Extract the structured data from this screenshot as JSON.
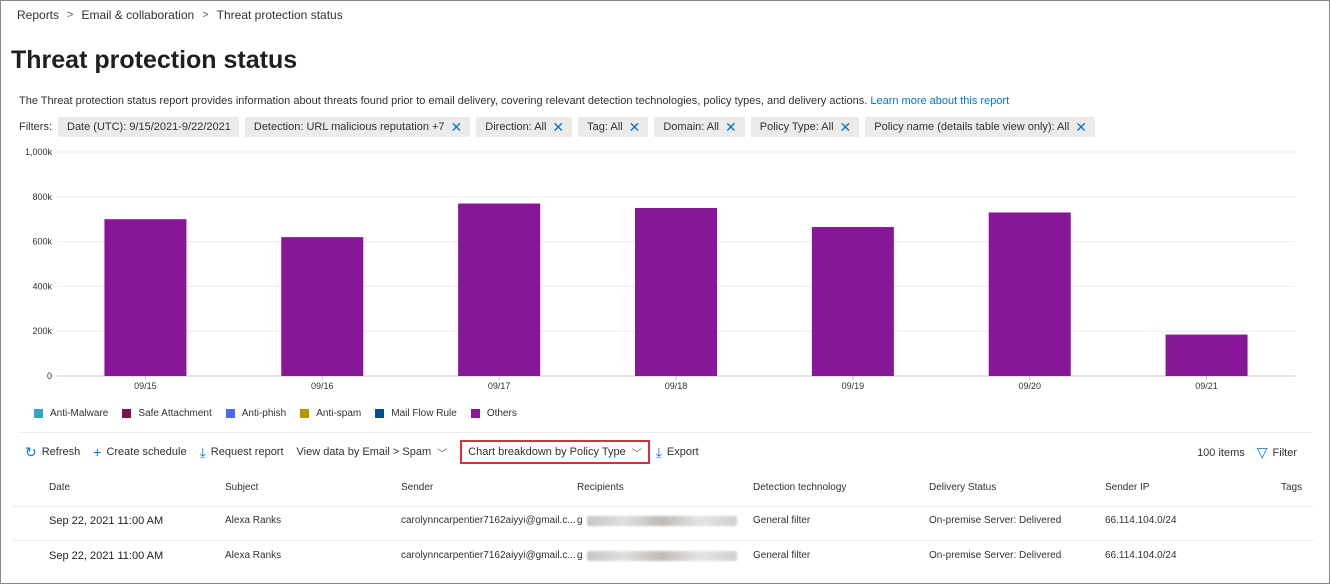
{
  "breadcrumb": [
    "Reports",
    "Email & collaboration",
    "Threat protection status"
  ],
  "page": {
    "title": "Threat protection status",
    "description": "The Threat protection status report provides information about threats found prior to email delivery, covering relevant detection technologies, policy types, and delivery actions.",
    "learn_more": "Learn more about this report"
  },
  "filters": {
    "label": "Filters:",
    "items": [
      "Date (UTC): 9/15/2021-9/22/2021",
      "Detection: URL malicious reputation +7",
      "Direction: All",
      "Tag: All",
      "Domain: All",
      "Policy Type: All",
      "Policy name (details table view only): All"
    ],
    "removable": [
      false,
      true,
      true,
      true,
      true,
      true,
      true
    ]
  },
  "chart_data": {
    "type": "bar",
    "categories": [
      "09/15",
      "09/16",
      "09/17",
      "09/18",
      "09/19",
      "09/20",
      "09/21"
    ],
    "series": [
      {
        "name": "Anti-Malware",
        "color": "#2ea8c2",
        "values": [
          0,
          0,
          0,
          0,
          0,
          0,
          0
        ]
      },
      {
        "name": "Safe Attachment",
        "color": "#7a1350",
        "values": [
          0,
          0,
          0,
          0,
          0,
          0,
          0
        ]
      },
      {
        "name": "Anti-phish",
        "color": "#4f6bed",
        "values": [
          0,
          0,
          0,
          0,
          0,
          0,
          0
        ]
      },
      {
        "name": "Anti-spam",
        "color": "#b89500",
        "values": [
          0,
          0,
          0,
          0,
          0,
          0,
          0
        ]
      },
      {
        "name": "Mail Flow Rule",
        "color": "#004e8c",
        "values": [
          0,
          0,
          0,
          0,
          0,
          0,
          0
        ]
      },
      {
        "name": "Others",
        "color": "#881798",
        "values": [
          700000,
          620000,
          770000,
          750000,
          665000,
          730000,
          185000
        ]
      }
    ],
    "ylim": [
      0,
      1000000
    ],
    "yticks": [
      0,
      200000,
      400000,
      600000,
      800000,
      1000000
    ],
    "ytick_labels": [
      "0",
      "200k",
      "400k",
      "600k",
      "800k",
      "1,000k"
    ],
    "grid": true,
    "legend": "bottom-left"
  },
  "toolbar": {
    "refresh": "Refresh",
    "create_schedule": "Create schedule",
    "request_report": "Request report",
    "view_data": "View data by Email > Spam",
    "chart_breakdown": "Chart breakdown by Policy Type",
    "export": "Export",
    "item_count": "100 items",
    "filter": "Filter"
  },
  "icons": {
    "refresh": "refresh-icon",
    "create": "plus-icon",
    "request": "download-icon",
    "export": "download-icon",
    "filter": "funnel-icon",
    "dropdown": "chevron-down-icon"
  },
  "table": {
    "columns": [
      "Date",
      "Subject",
      "Sender",
      "Recipients",
      "Detection technology",
      "Delivery Status",
      "Sender IP",
      "Tags"
    ],
    "rows": [
      {
        "date": "Sep 22, 2021 11:00 AM",
        "subject": "Alexa Ranks",
        "sender": "carolynncarpentier7162aiyyi@gmail.c...",
        "recipient": "g",
        "detection": "General filter",
        "delivery": "On-premise Server: Delivered",
        "ip": "66.114.104.0/24",
        "tags": ""
      },
      {
        "date": "Sep 22, 2021 11:00 AM",
        "subject": "Alexa Ranks",
        "sender": "carolynncarpentier7162aiyyi@gmail.c...",
        "recipient": "g",
        "detection": "General filter",
        "delivery": "On-premise Server: Delivered",
        "ip": "66.114.104.0/24",
        "tags": ""
      }
    ]
  },
  "colors": {
    "accent": "#0078d4",
    "highlight_border": "#d13438",
    "bar": "#881798"
  }
}
